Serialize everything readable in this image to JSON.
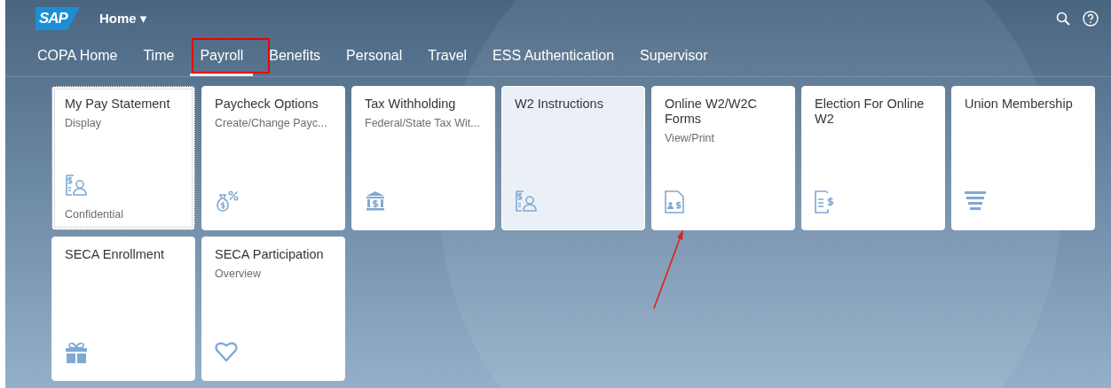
{
  "header": {
    "logo": "SAP",
    "title": "Home ▾"
  },
  "tabs": [
    {
      "label": "COPA Home",
      "selected": false
    },
    {
      "label": "Time",
      "selected": false
    },
    {
      "label": "Payroll",
      "selected": true
    },
    {
      "label": "Benefits",
      "selected": false
    },
    {
      "label": "Personal",
      "selected": false
    },
    {
      "label": "Travel",
      "selected": false
    },
    {
      "label": "ESS Authentication",
      "selected": false
    },
    {
      "label": "Supervisor",
      "selected": false
    }
  ],
  "tiles": [
    {
      "title": "My Pay Statement",
      "subtitle": "Display",
      "footer": "Confidential",
      "kind": "person-dollar",
      "focused": true,
      "hovered": false
    },
    {
      "title": "Paycheck Options",
      "subtitle": "Create/Change Payc...",
      "kind": "moneybag",
      "focused": false,
      "hovered": false
    },
    {
      "title": "Tax Withholding",
      "subtitle": "Federal/State Tax Wit...",
      "kind": "bank",
      "focused": false,
      "hovered": false
    },
    {
      "title": "W2 Instructions",
      "kind": "person-dollar",
      "focused": false,
      "hovered": true
    },
    {
      "title": "Online W2/W2C Forms",
      "subtitle": "View/Print",
      "kind": "doc-person",
      "focused": false,
      "hovered": false
    },
    {
      "title": "Election For Online W2",
      "kind": "doc-dollar",
      "focused": false,
      "hovered": false
    },
    {
      "title": "Union Membership",
      "kind": "funnel",
      "focused": false,
      "hovered": false
    },
    {
      "title": "SECA Enrollment",
      "kind": "gift",
      "focused": false,
      "hovered": false
    },
    {
      "title": "SECA Participation",
      "subtitle": "Overview",
      "kind": "heart",
      "focused": false,
      "hovered": false
    }
  ]
}
